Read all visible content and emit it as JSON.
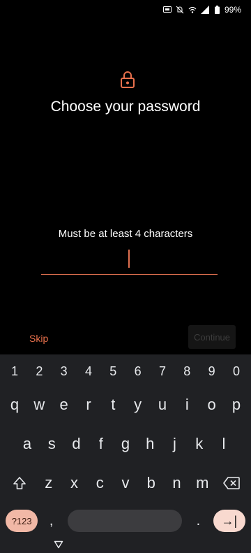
{
  "status_bar": {
    "battery_percent": "99%",
    "icons": [
      "screen-cast-icon",
      "notifications-off-icon",
      "wifi-data-icon",
      "signal-icon",
      "battery-icon"
    ]
  },
  "header": {
    "icon": "lock-icon",
    "title": "Choose your password"
  },
  "password": {
    "hint": "Must be at least 4 characters",
    "value": ""
  },
  "actions": {
    "skip_label": "Skip",
    "continue_label": "Continue"
  },
  "keyboard": {
    "numbers": [
      "1",
      "2",
      "3",
      "4",
      "5",
      "6",
      "7",
      "8",
      "9",
      "0"
    ],
    "row1": [
      "q",
      "w",
      "e",
      "r",
      "t",
      "y",
      "u",
      "i",
      "o",
      "p"
    ],
    "row2": [
      "a",
      "s",
      "d",
      "f",
      "g",
      "h",
      "j",
      "k",
      "l"
    ],
    "row3": [
      "z",
      "x",
      "c",
      "v",
      "b",
      "n",
      "m"
    ],
    "symbols_label": "?123",
    "comma": ",",
    "period": ".",
    "enter_symbol": "→|",
    "shift_icon": "shift-icon",
    "backspace_icon": "backspace-icon",
    "hide_icon": "hide-keyboard-icon"
  },
  "colors": {
    "accent": "#e8704c",
    "keyboard_bg": "#202124",
    "symbols_key_bg": "#f1b8a6",
    "enter_key_bg": "#f8d9cf"
  }
}
